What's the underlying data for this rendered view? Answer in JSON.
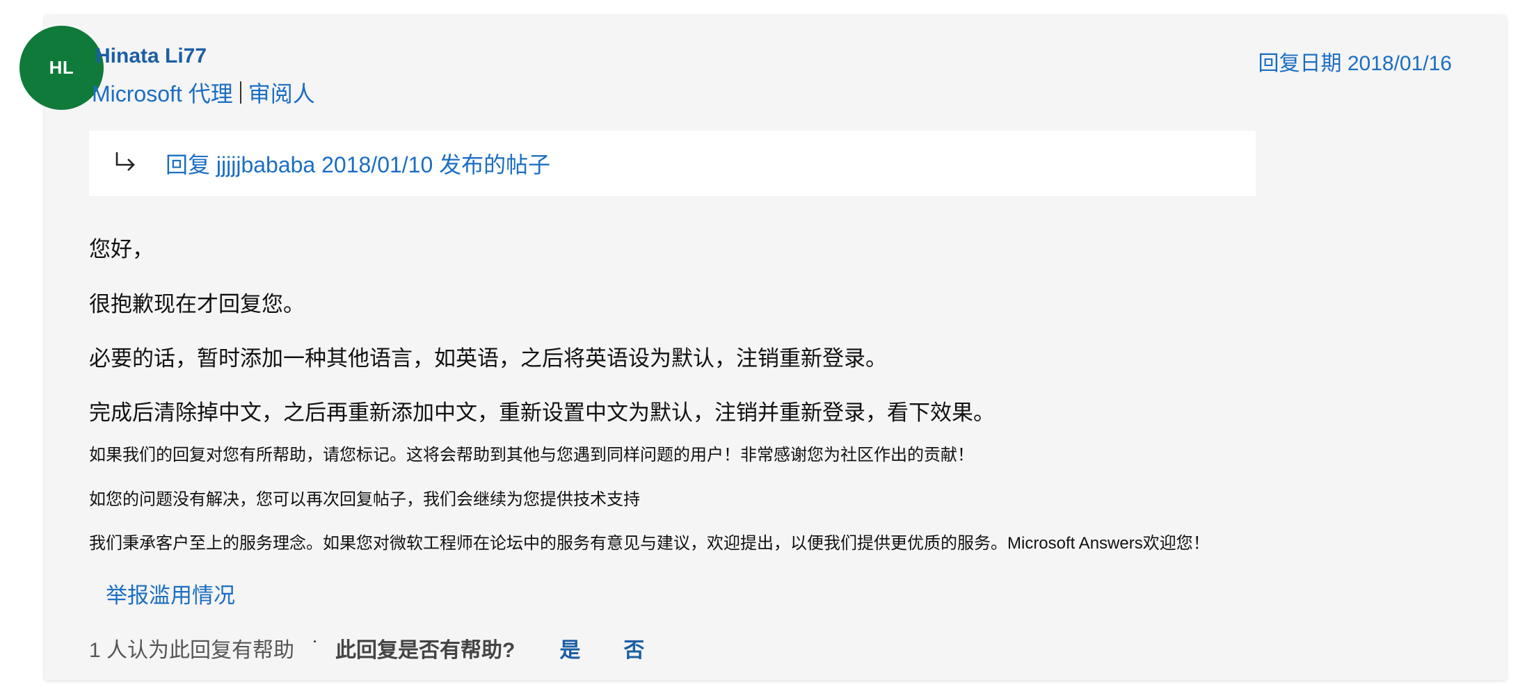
{
  "author": {
    "initials": "HL",
    "name": "Hinata Li77",
    "role": "Microsoft 代理",
    "role2": "审阅人",
    "avatar_color": "#0f7a3a"
  },
  "reply_date": "回复日期 2018/01/16",
  "reply_to": {
    "icon": "reply-arrow-icon",
    "text": "回复 jjjjjbababa 2018/01/10 发布的帖子"
  },
  "body": {
    "greeting": "您好，",
    "line1": "很抱歉现在才回复您。",
    "line2": "必要的话，暂时添加一种其他语言，如英语，之后将英语设为默认，注销重新登录。",
    "line3": "完成后清除掉中文，之后再重新添加中文，重新设置中文为默认，注销并重新登录，看下效果。"
  },
  "signature": {
    "line1": "如果我们的回复对您有所帮助，请您标记。这将会帮助到其他与您遇到同样问题的用户！非常感谢您为社区作出的贡献！",
    "line2": "如您的问题没有解决，您可以再次回复帖子，我们会继续为您提供技术支持",
    "line3": "我们秉承客户至上的服务理念。如果您对微软工程师在论坛中的服务有意见与建议，欢迎提出，以便我们提供更优质的服务。Microsoft Answers欢迎您！"
  },
  "actions": {
    "report": "举报滥用情况",
    "helpful_count": "1 人认为此回复有帮助",
    "helpful_question": "此回复是否有帮助?",
    "yes": "是",
    "no": "否"
  },
  "colors": {
    "link": "#1b6ec2",
    "card_bg": "#f5f5f5"
  }
}
